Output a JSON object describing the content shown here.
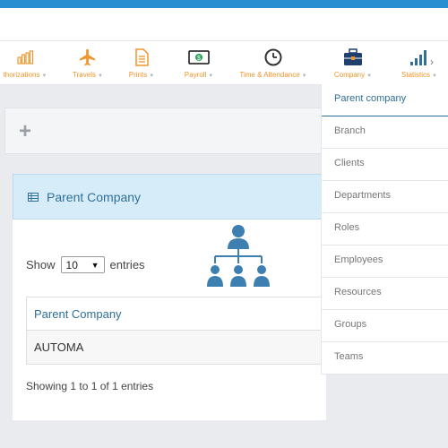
{
  "nav": {
    "items": [
      {
        "label": "thorizations",
        "icon": "bar-chart-icon"
      },
      {
        "label": "Travels",
        "icon": "airplane-icon"
      },
      {
        "label": "Prints",
        "icon": "document-icon"
      },
      {
        "label": "Payroll",
        "icon": "banknote-icon"
      },
      {
        "label": "Time & Attendance",
        "icon": "clock-icon"
      },
      {
        "label": "Company",
        "icon": "briefcase-icon"
      },
      {
        "label": "Statistics",
        "icon": "signal-bars-icon"
      }
    ]
  },
  "dropdown": {
    "items": [
      {
        "label": "Parent company",
        "active": true
      },
      {
        "label": "Branch"
      },
      {
        "label": "Clients"
      },
      {
        "label": "Departments"
      },
      {
        "label": "Roles"
      },
      {
        "label": "Employees"
      },
      {
        "label": "Resources"
      },
      {
        "label": "Groups"
      },
      {
        "label": "Teams"
      }
    ]
  },
  "panel": {
    "title": "Parent Company",
    "show_label": "Show",
    "entries_value": "10",
    "entries_label": "entries",
    "table": {
      "header": "Parent Company",
      "rows": [
        "AUTOMA"
      ]
    },
    "info": "Showing 1 to 1 of 1 entries"
  },
  "colors": {
    "topbar": "#2a8fd0",
    "nav_accent": "#f0952a",
    "link": "#2f6f98"
  }
}
